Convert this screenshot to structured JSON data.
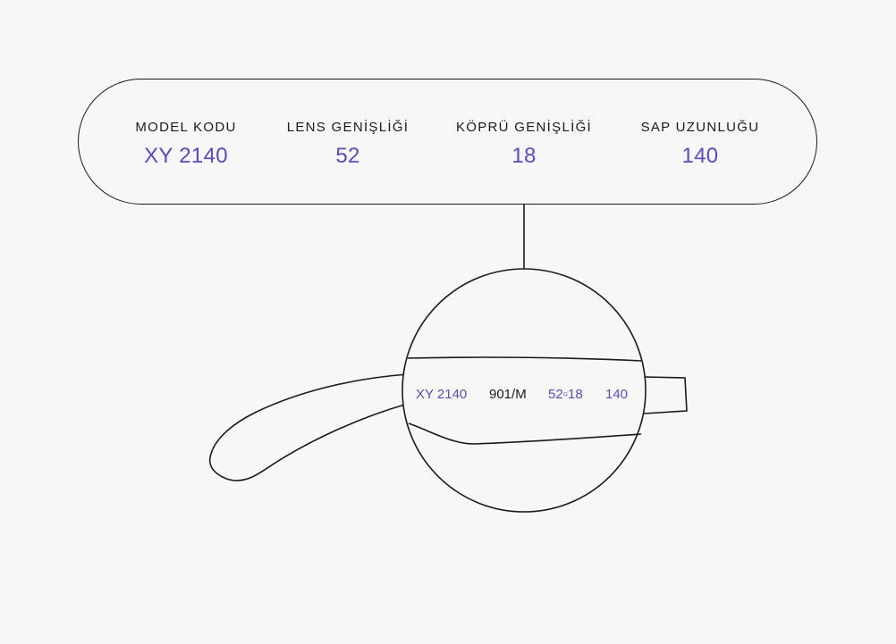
{
  "colors": {
    "accent": "#5549d6",
    "line": "#1a1a1a",
    "background": "#f7f7f7"
  },
  "specs": [
    {
      "label": "MODEL KODU",
      "value": "XY 2140"
    },
    {
      "label": "LENS GENİŞLİĞİ",
      "value": "52"
    },
    {
      "label": "KÖPRÜ GENİŞLİĞİ",
      "value": "18"
    },
    {
      "label": "SAP UZUNLUĞU",
      "value": "140"
    }
  ],
  "temple": {
    "model": "XY 2140",
    "color_code": "901/M",
    "lens_bridge": "52▫18",
    "temple_length": "140"
  }
}
